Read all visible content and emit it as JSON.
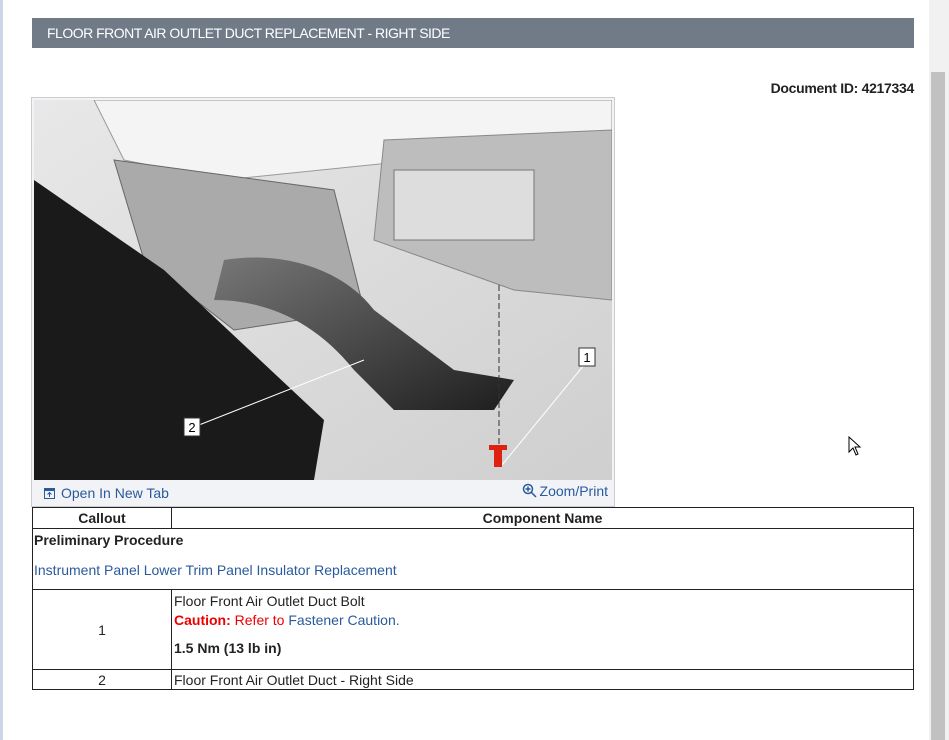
{
  "header": {
    "title": "FLOOR FRONT AIR OUTLET DUCT REPLACEMENT - RIGHT SIDE"
  },
  "document_id": "Document ID: 4217334",
  "figure": {
    "callouts": [
      "1",
      "2"
    ],
    "open_tab_label": "Open In New Tab",
    "zoom_print_label": "Zoom/Print"
  },
  "table": {
    "headers": [
      "Callout",
      "Component Name"
    ],
    "preliminary": {
      "title": "Preliminary Procedure",
      "link": "Instrument Panel Lower Trim Panel Insulator Replacement"
    },
    "rows": [
      {
        "callout": "1",
        "name": "Floor Front Air Outlet Duct Bolt",
        "caution_label": "Caution:",
        "caution_text": "Refer to",
        "caution_link": "Fastener Caution.",
        "torque": "1.5 Nm (13 lb in)"
      },
      {
        "callout": "2",
        "name": "Floor Front Air Outlet Duct - Right Side"
      }
    ]
  },
  "colors": {
    "header_bg": "#717b88",
    "link": "#2a5a9c",
    "caution": "#e00000"
  }
}
